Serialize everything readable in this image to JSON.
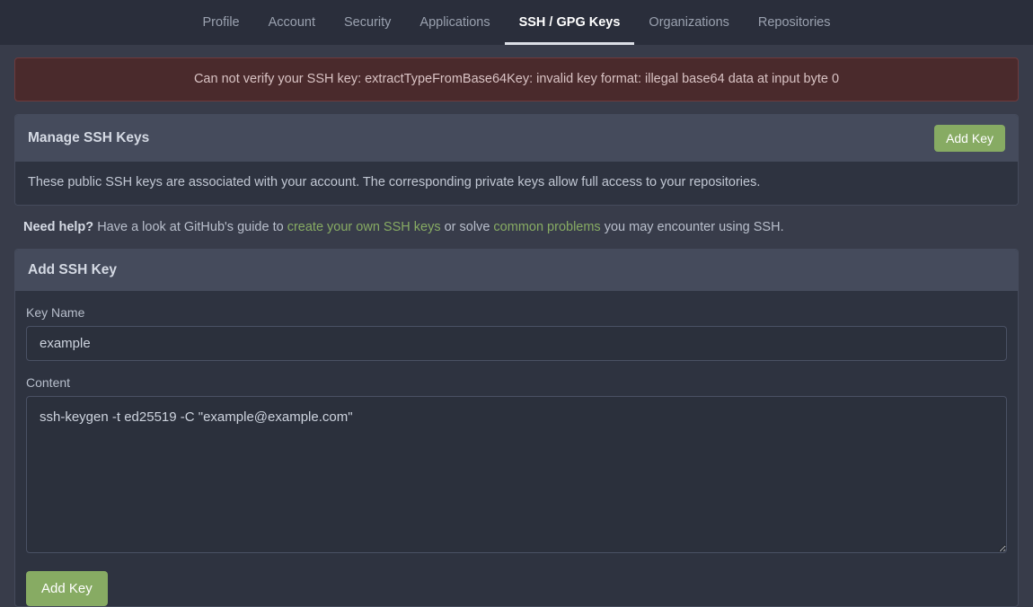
{
  "nav": {
    "items": [
      {
        "label": "Profile",
        "active": false
      },
      {
        "label": "Account",
        "active": false
      },
      {
        "label": "Security",
        "active": false
      },
      {
        "label": "Applications",
        "active": false
      },
      {
        "label": "SSH / GPG Keys",
        "active": true
      },
      {
        "label": "Organizations",
        "active": false
      },
      {
        "label": "Repositories",
        "active": false
      }
    ]
  },
  "alert": {
    "message": "Can not verify your SSH key: extractTypeFromBase64Key: invalid key format: illegal base64 data at input byte 0",
    "color": "#4a2a2c"
  },
  "manage_panel": {
    "title": "Manage SSH Keys",
    "add_key_label": "Add Key",
    "description": "These public SSH keys are associated with your account. The corresponding private keys allow full access to your repositories."
  },
  "help": {
    "lead": "Need help?",
    "text_before": "Have a look at GitHub's guide to",
    "link1": "create your own SSH keys",
    "text_middle": "or solve",
    "link2": "common problems",
    "text_after": "you may encounter using SSH.",
    "link_color": "#87ab63"
  },
  "add_panel": {
    "title": "Add SSH Key",
    "key_name_label": "Key Name",
    "key_name_value": "example",
    "key_name_placeholder": "Key Name",
    "content_label": "Content",
    "content_value": "ssh-keygen -t ed25519 -C \"example@example.com\"",
    "content_placeholder": "Content",
    "submit_label": "Add Key"
  },
  "theme": {
    "page_bg": "#383c4a",
    "navbar_bg": "#2a2e3b",
    "panel_head_bg": "#454b5c",
    "panel_body_bg": "#2e3340",
    "accent_green": "#87ab63"
  }
}
